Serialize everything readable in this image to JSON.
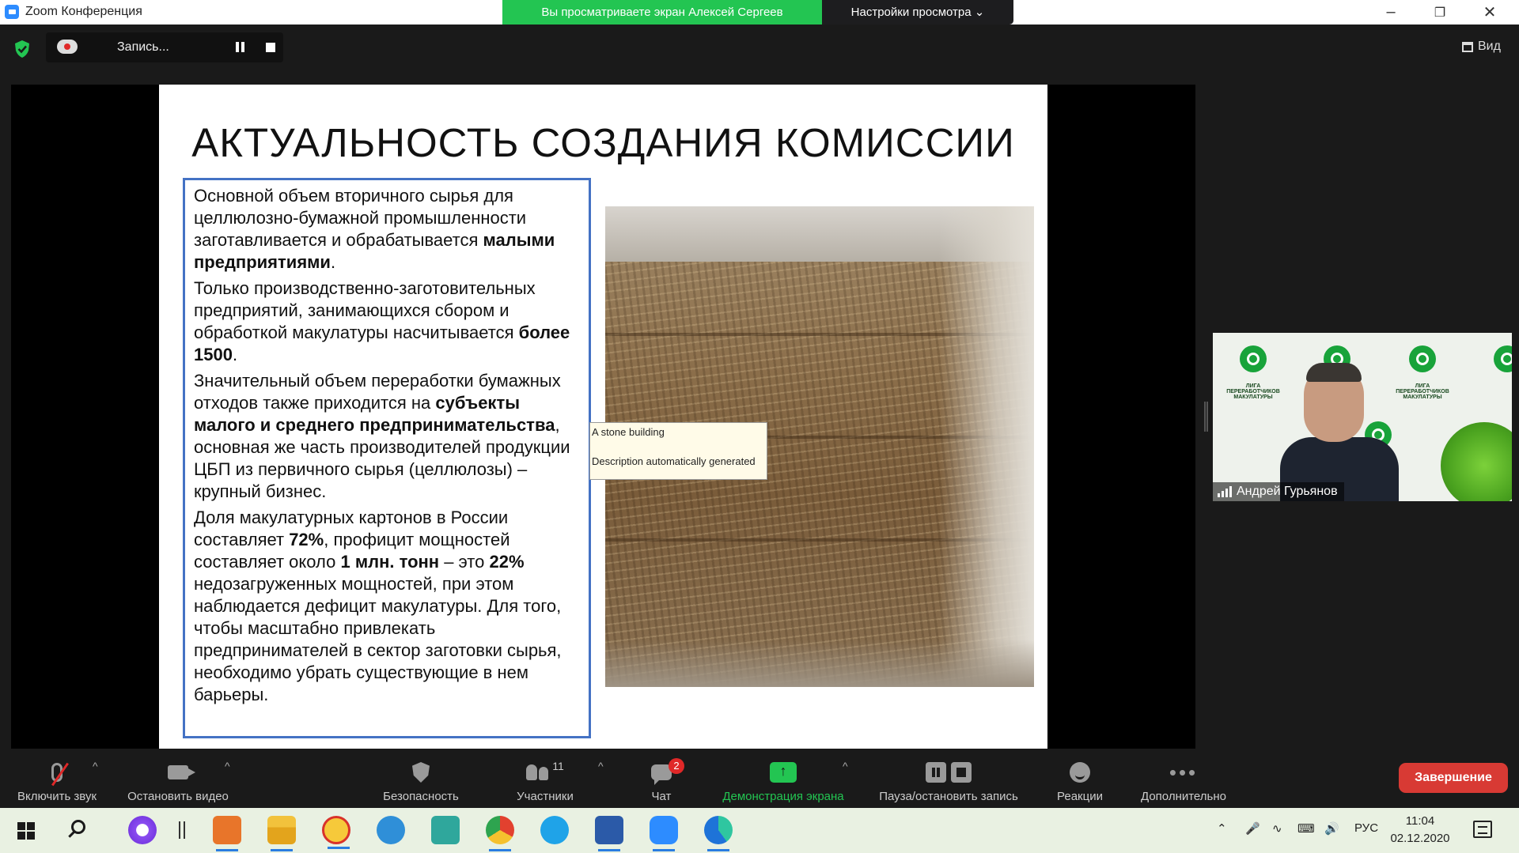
{
  "window": {
    "title": "Zoom Конференция",
    "share_banner": "Вы просматриваете экран Алексей Сергеев",
    "view_options": "Настройки просмотра",
    "view_options_icon": "chevron-down-icon",
    "minimize_icon": "minimize-icon",
    "maximize_icon": "restore-icon",
    "close_icon": "close-icon"
  },
  "top_bar": {
    "recording_label": "Запись...",
    "view_label": "Вид"
  },
  "slide": {
    "title": "АКТУАЛЬНОСТЬ СОЗДАНИЯ КОМИССИИ",
    "p1_a": "Основной объем вторичного сырья для целлюлозно-бумажной промышленности заготавливается и обрабатывается ",
    "p1_b": "малыми предприятиями",
    "p1_c": ".",
    "p2_a": "Только производственно-заготовительных предприятий, занимающихся сбором и обработкой макулатуры насчитывается ",
    "p2_b": "более 1500",
    "p2_c": ".",
    "p3_a": "Значительный объем переработки бумажных отходов также приходится на ",
    "p3_b": "субъекты малого и среднего предпринимательства",
    "p3_c": ", основная же часть производителей продукции ЦБП из первичного сырья (целлюлозы) – крупный бизнес.",
    "p4_a": "Доля макулатурных картонов в России составляет ",
    "p4_b": "72%",
    "p4_c": ", профицит мощностей составляет около ",
    "p4_d": "1 млн. тонн",
    "p4_e": " – это ",
    "p4_f": "22%",
    "p4_g": " недозагруженных мощностей, при этом наблюдается дефицит макулатуры. Для того, чтобы масштабно привлекать предпринимателей в сектор заготовки сырья, необходимо убрать существующие в нем барьеры.",
    "tooltip_line1": "A stone building",
    "tooltip_line2": "Description automatically generated"
  },
  "participant": {
    "name": "Андрей Гурьянов",
    "logo_caption": "ЛИГА ПЕРЕРАБОТЧИКОВ МАКУЛАТУРЫ"
  },
  "toolbar": {
    "mute_label": "Включить звук",
    "video_label": "Остановить видео",
    "security_label": "Безопасность",
    "participants_label": "Участники",
    "participants_count": "11",
    "chat_label": "Чат",
    "chat_badge": "2",
    "share_label": "Демонстрация экрана",
    "pause_record_label": "Пауза/остановить запись",
    "reactions_label": "Реакции",
    "more_label": "Дополнительно",
    "end_label": "Завершение",
    "caret": "^"
  },
  "taskbar": {
    "language": "РУС",
    "time": "11:04",
    "date": "02.12.2020",
    "icons": [
      "windows-start-icon",
      "search-icon",
      "cortana-icon",
      "task-view-icon",
      "outlook-icon",
      "file-explorer-icon",
      "1c-icon",
      "internet-explorer-icon",
      "photo-viewer-icon",
      "chrome-icon",
      "skype-icon",
      "word-icon",
      "zoom-icon",
      "edge-icon"
    ]
  },
  "colors": {
    "share_green": "#23c552",
    "end_red": "#d83a34",
    "slide_border_blue": "#4472c4"
  }
}
